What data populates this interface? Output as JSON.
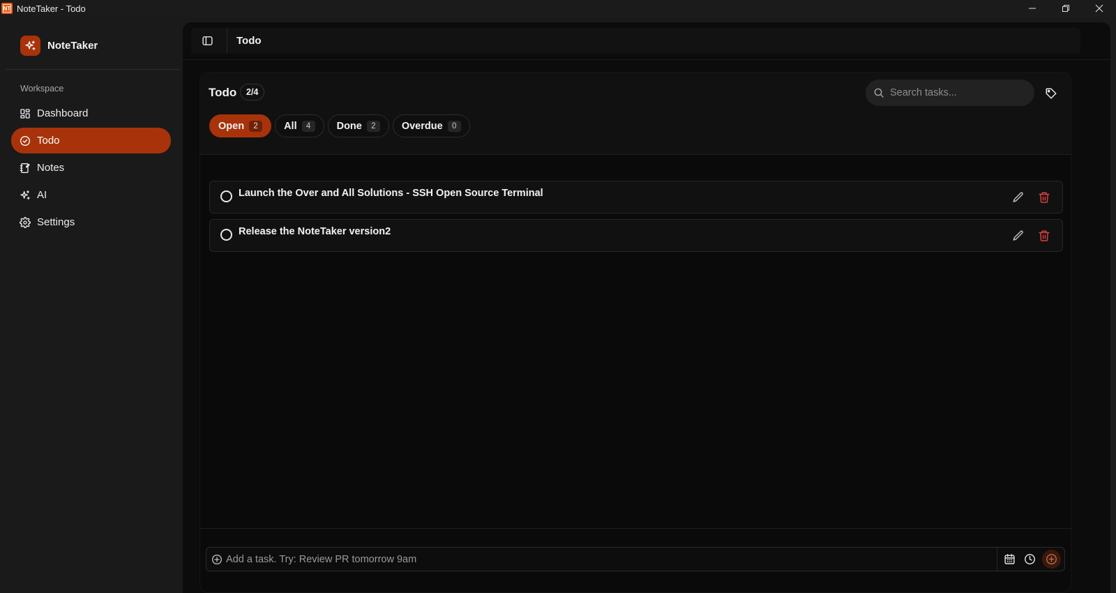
{
  "window": {
    "title": "NoteTaker - Todo",
    "app_icon_text": "NT"
  },
  "colors": {
    "accent": "#a8330b",
    "danger": "#d94141",
    "background": "#0a0a0a",
    "sidebar": "#1a1a1a"
  },
  "sidebar": {
    "brand": "NoteTaker",
    "section_label": "Workspace",
    "items": [
      {
        "label": "Dashboard",
        "icon": "dashboard-icon",
        "active": false
      },
      {
        "label": "Todo",
        "icon": "check-circle-icon",
        "active": true
      },
      {
        "label": "Notes",
        "icon": "notebook-icon",
        "active": false
      },
      {
        "label": "AI",
        "icon": "sparkles-icon",
        "active": false
      },
      {
        "label": "Settings",
        "icon": "gear-icon",
        "active": false
      }
    ]
  },
  "topbar": {
    "title": "Todo"
  },
  "todo": {
    "title": "Todo",
    "count": "2/4",
    "search_placeholder": "Search tasks...",
    "filters": [
      {
        "label": "Open",
        "count": "2",
        "active": true
      },
      {
        "label": "All",
        "count": "4",
        "active": false
      },
      {
        "label": "Done",
        "count": "2",
        "active": false
      },
      {
        "label": "Overdue",
        "count": "0",
        "active": false
      }
    ],
    "tasks": [
      {
        "title": "Launch the Over and All Solutions - SSH Open Source Terminal",
        "done": false
      },
      {
        "title": "Release the NoteTaker version2",
        "done": false
      }
    ],
    "composer_placeholder": "Add a task. Try: Review PR tomorrow 9am"
  }
}
